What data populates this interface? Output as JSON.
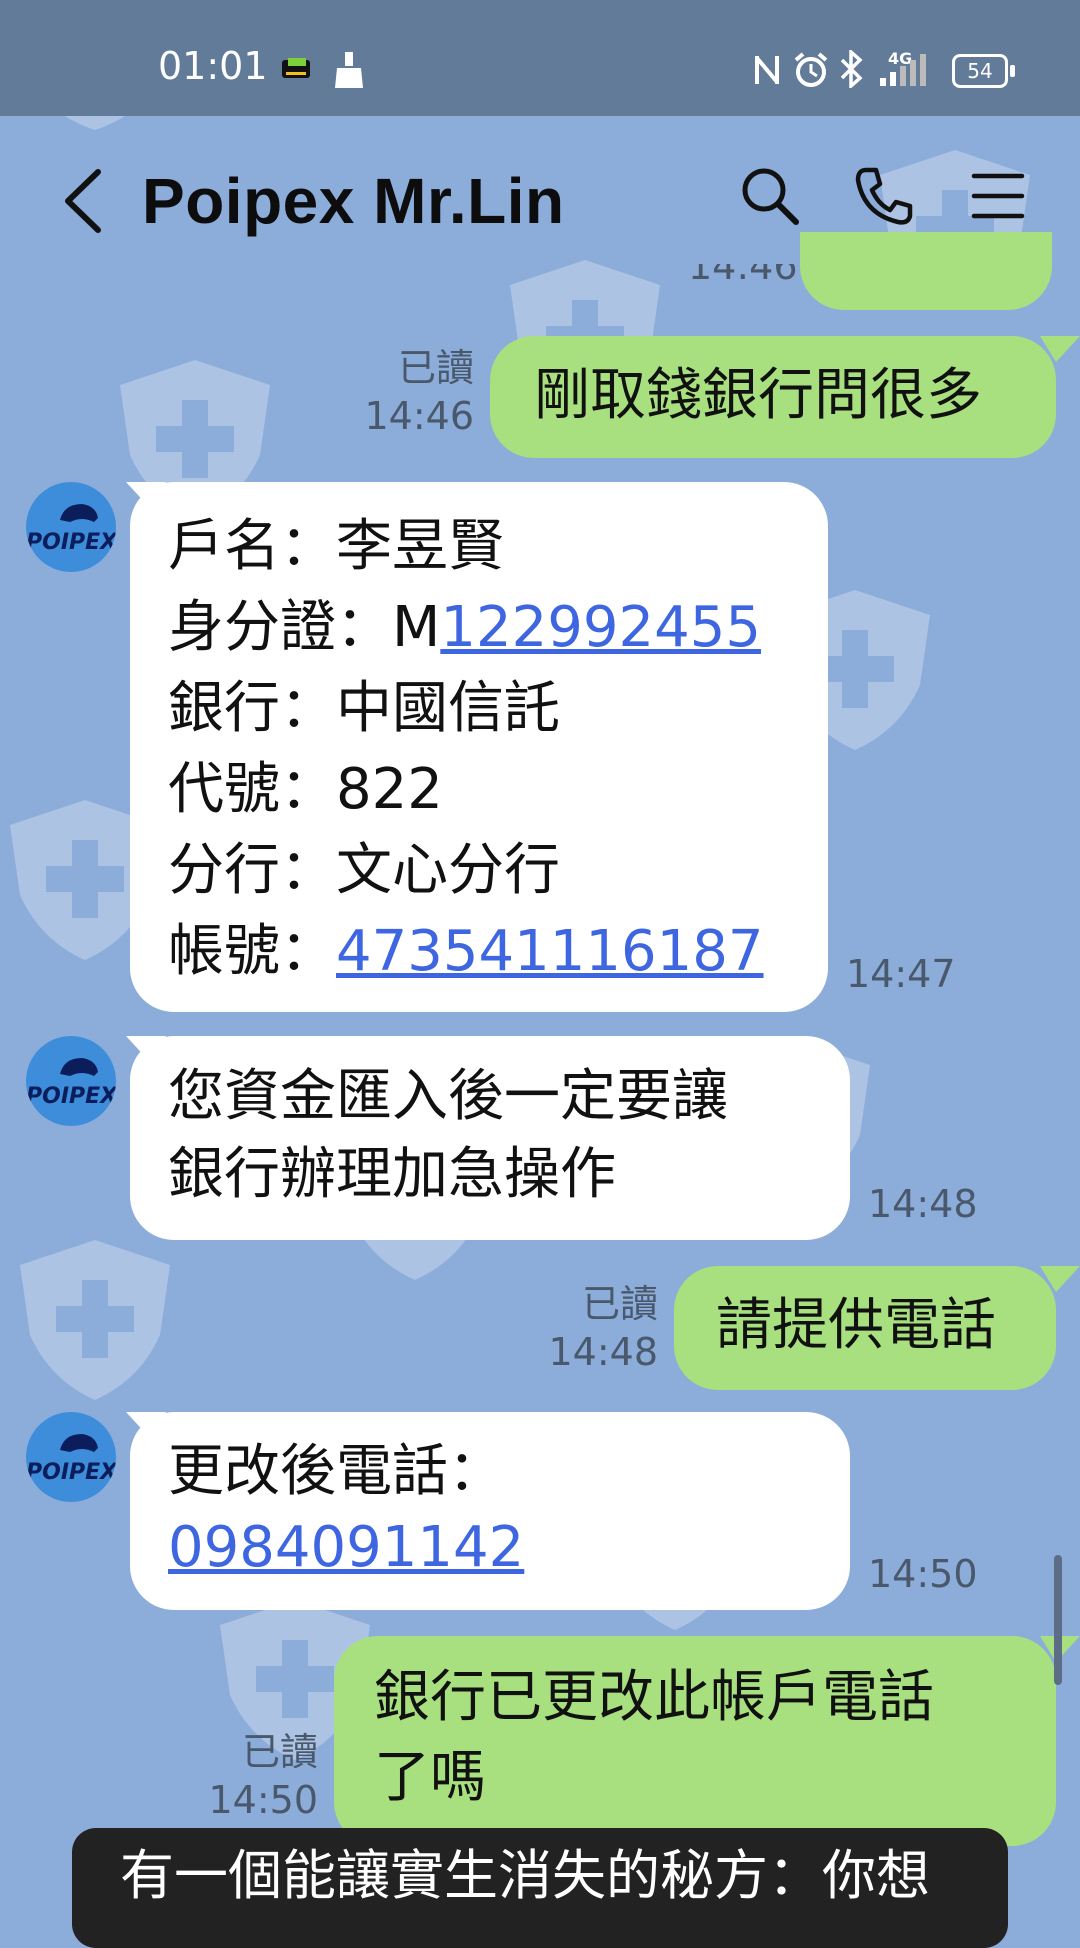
{
  "status_bar": {
    "time": "01:01",
    "network": "4G",
    "battery": "54"
  },
  "header": {
    "title": "Poipex  Mr.Lin"
  },
  "avatar": {
    "text": "POIPEX"
  },
  "messages": [
    {
      "partial_time": "14:46"
    },
    {
      "read": "已讀",
      "time": "14:46",
      "text": "剛取錢銀行問很多"
    },
    {
      "time": "14:47",
      "lines": [
        {
          "prefix": "戶名：李昱賢",
          "link": ""
        },
        {
          "prefix": "身分證：M",
          "link": "122992455"
        },
        {
          "prefix": "銀行：中國信託",
          "link": ""
        },
        {
          "prefix": "代號：822",
          "link": ""
        },
        {
          "prefix": "分行：文心分行",
          "link": ""
        },
        {
          "prefix": "帳號：",
          "link": "473541116187"
        }
      ]
    },
    {
      "time": "14:48",
      "lines": [
        "您資金匯入後一定要讓",
        "銀行辦理加急操作"
      ]
    },
    {
      "read": "已讀",
      "time": "14:48",
      "text": "請提供電話"
    },
    {
      "time": "14:50",
      "line1": "更改後電話：",
      "link": "0984091142"
    },
    {
      "read": "已讀",
      "time": "14:50",
      "lines": [
        "銀行已更改此帳戶電話",
        "了嗎"
      ]
    }
  ],
  "toast": {
    "text": "有一個能讓實生消失的秘方：你想"
  },
  "colors": {
    "background": "#8CACDA",
    "status_bar": "#627B98",
    "outgoing_bubble": "#A8E07F",
    "incoming_bubble": "#FFFFFF",
    "link": "#3D66E0"
  },
  "icons": [
    "back-icon",
    "search-icon",
    "phone-icon",
    "menu-icon",
    "sim-icon",
    "cleaner-icon",
    "nfc-icon",
    "alarm-icon",
    "bluetooth-icon",
    "signal-icon",
    "battery-icon"
  ]
}
